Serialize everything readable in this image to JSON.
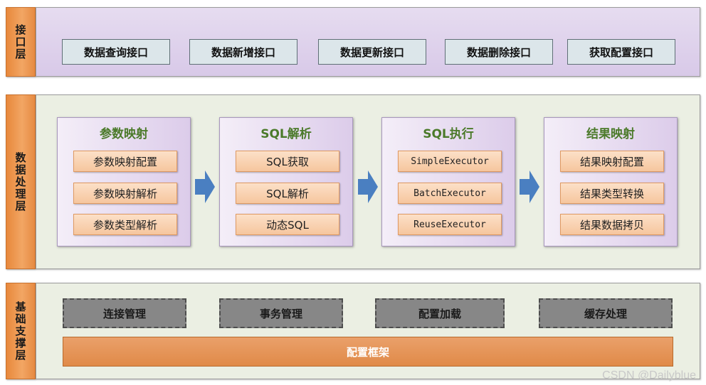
{
  "layers": {
    "interface": {
      "label": "接口层",
      "items": [
        "数据查询接口",
        "数据新增接口",
        "数据更新接口",
        "数据删除接口",
        "获取配置接口"
      ]
    },
    "processing": {
      "label": "数据处理层",
      "stages": [
        {
          "title": "参数映射",
          "items": [
            "参数映射配置",
            "参数映射解析",
            "参数类型解析"
          ]
        },
        {
          "title": "SQL解析",
          "items": [
            "SQL获取",
            "SQL解析",
            "动态SQL"
          ]
        },
        {
          "title": "SQL执行",
          "items": [
            "SimpleExecutor",
            "BatchExecutor",
            "ReuseExecutor"
          ]
        },
        {
          "title": "结果映射",
          "items": [
            "结果映射配置",
            "结果类型转换",
            "结果数据拷贝"
          ]
        }
      ]
    },
    "support": {
      "label": "基础支撑层",
      "items": [
        "连接管理",
        "事务管理",
        "配置加载",
        "缓存处理"
      ],
      "framework": "配置框架"
    }
  },
  "watermark": "CSDN @Dailyblue",
  "colors": {
    "layer_label": "#e8883b",
    "interface_panel": "#dccdea",
    "processing_panel": "#ebefe3",
    "stage_title": "#4b7a2a",
    "sub_item": "#f6c69e",
    "arrow": "#4a7fc1",
    "support_box": "#878787",
    "framework": "#e08a48"
  }
}
